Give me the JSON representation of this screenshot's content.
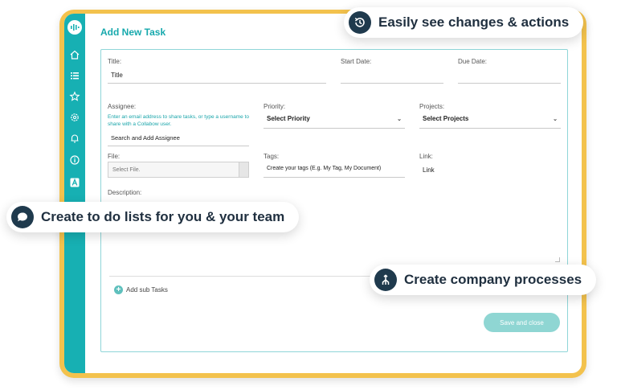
{
  "form": {
    "heading": "Add New Task",
    "title_label": "Title:",
    "title_value": "Title",
    "start_date_label": "Start Date:",
    "due_date_label": "Due Date:",
    "assignee_label": "Assignee:",
    "assignee_hint": "Enter an email address to share tasks, or type a username to share with a Collabow user.",
    "assignee_placeholder": "Search and Add Assignee",
    "priority_label": "Priority:",
    "priority_value": "Select Priority",
    "projects_label": "Projects:",
    "projects_value": "Select Projects",
    "file_label": "File:",
    "file_placeholder": "Select File.",
    "tags_label": "Tags:",
    "tags_placeholder": "Create your tags (E.g. My Tag, My Document)",
    "link_label": "Link:",
    "link_value": "Link",
    "description_label": "Description:",
    "add_sub_tasks": "Add sub Tasks",
    "save_button": "Save and close"
  },
  "sidebar": {
    "icons": [
      "logo-icon",
      "home-icon",
      "list-icon",
      "star-icon",
      "settings-icon",
      "bell-icon",
      "info-icon",
      "a-letter-icon"
    ]
  },
  "callouts": {
    "changes": "Easily see changes & actions",
    "todo": "Create to do lists for you & your team",
    "processes": "Create company processes"
  },
  "colors": {
    "accent": "#17b0b3",
    "frame": "#f3c24d",
    "callout_icon": "#1f3a4d",
    "save_button": "#8fd6d3"
  }
}
